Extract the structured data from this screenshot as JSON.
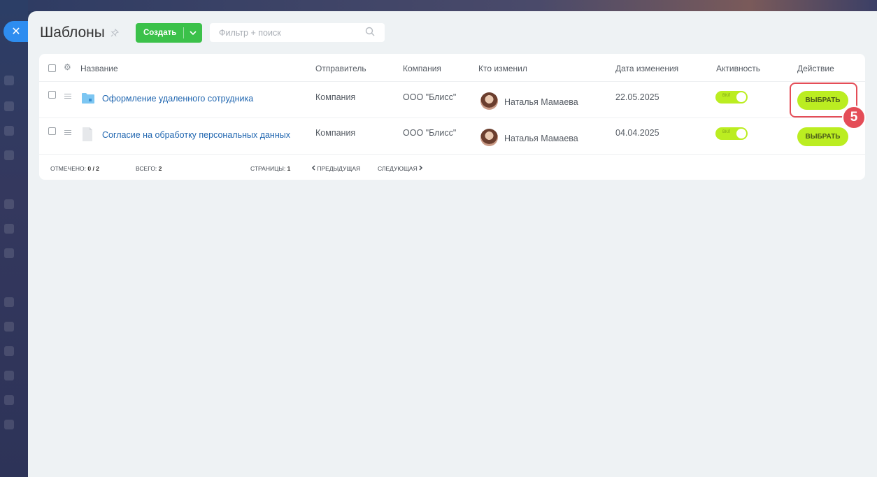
{
  "close_symbol": "✕",
  "header": {
    "title": "Шаблоны",
    "pin_icon": "pin-icon",
    "create_label": "Создать",
    "create_arrow": "⌄",
    "search_placeholder": "Фильтр + поиск"
  },
  "grid": {
    "columns": [
      "Название",
      "Отправитель",
      "Компания",
      "Кто изменил",
      "Дата изменения",
      "Активность",
      "Действие"
    ],
    "rows": [
      {
        "name": "Оформление удаленного сотрудника",
        "icon": "folder-icon",
        "sender": "Компания",
        "company": "ООО \"Блисс\"",
        "modified_by": "Наталья Мамаева",
        "date": "22.05.2025",
        "active": true,
        "toggle_text": "ВКЛ",
        "action": "ВЫБРАТЬ"
      },
      {
        "name": "Согласие на обработку персональных данных",
        "icon": "document-icon",
        "sender": "Компания",
        "company": "ООО \"Блисс\"",
        "modified_by": "Наталья Мамаева",
        "date": "04.04.2025",
        "active": true,
        "toggle_text": "ВКЛ",
        "action": "ВЫБРАТЬ"
      }
    ]
  },
  "footer": {
    "marked_label": "ОТМЕЧЕНО:",
    "marked_value": "0 / 2",
    "total_label": "ВСЕГО:",
    "total_value": "2",
    "pages_label": "СТРАНИЦЫ:",
    "pages_value": "1",
    "prev_label": "ПРЕДЫДУЩАЯ",
    "next_label": "СЛЕДУЮЩАЯ"
  },
  "annotation": {
    "step_number": "5"
  },
  "colors": {
    "accent_green": "#3bc14a",
    "lime": "#bbed21",
    "link": "#2066b0",
    "highlight": "#e44d57",
    "close_blue": "#2e8df0"
  }
}
